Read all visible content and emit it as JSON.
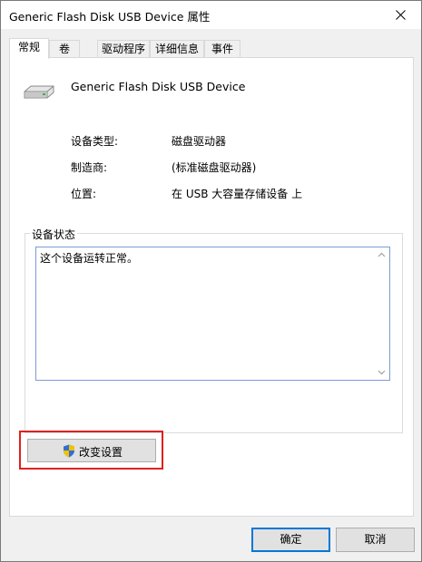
{
  "window": {
    "title": "Generic Flash Disk USB Device 属性"
  },
  "tabs": [
    {
      "label": "常规",
      "active": true
    },
    {
      "label": "卷",
      "active": false
    },
    {
      "label": "驱动程序",
      "active": false
    },
    {
      "label": "详细信息",
      "active": false
    },
    {
      "label": "事件",
      "active": false
    }
  ],
  "general": {
    "device_name": "Generic Flash Disk USB Device",
    "rows": [
      {
        "label": "设备类型:",
        "value": "磁盘驱动器"
      },
      {
        "label": "制造商:",
        "value": "(标准磁盘驱动器)"
      },
      {
        "label": "位置:",
        "value": "在 USB 大容量存储设备 上"
      }
    ],
    "status_group_title": "设备状态",
    "status_text": "这个设备运转正常。",
    "change_settings_label": "改变设置"
  },
  "buttons": {
    "ok": "确定",
    "cancel": "取消"
  },
  "colors": {
    "highlight": "#e02020",
    "default_button_border": "#0078d7"
  }
}
